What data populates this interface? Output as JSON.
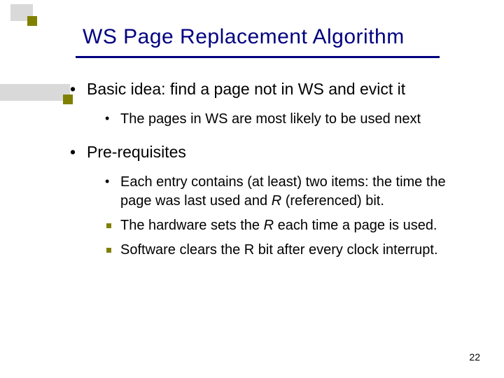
{
  "title": "WS Page Replacement Algorithm",
  "bullets": {
    "b1": "Basic idea: find a page not in WS and evict it",
    "b1_sub1": "The pages in WS are most likely to be used next",
    "b2": "Pre-requisites",
    "b2_sub1_a": "Each entry contains (at least) two items: the time the page was last used and ",
    "b2_sub1_r": "R",
    "b2_sub1_b": " (referenced) bit.",
    "b2_sub2_a": "The hardware sets the ",
    "b2_sub2_r": "R",
    "b2_sub2_b": " each time a page is used.",
    "b2_sub3": "Software clears the R bit after every clock interrupt."
  },
  "page_number": "22"
}
